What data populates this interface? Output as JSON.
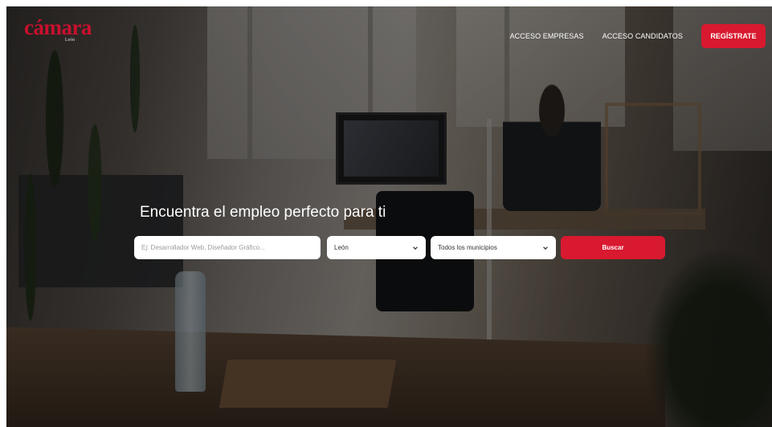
{
  "colors": {
    "accent": "#d8192f",
    "logo_red": "#c8102e"
  },
  "header": {
    "logo": {
      "word": "cámara",
      "sub": "León"
    },
    "nav": {
      "empresas": "ACCESO EMPRESAS",
      "candidatos": "ACCESO CANDIDATOS",
      "register": "REGÍSTRATE"
    }
  },
  "hero": {
    "headline": "Encuentra el empleo perfecto para ti",
    "search": {
      "keyword_placeholder": "Ej: Desarrollador Web, Diseñador Gráfico...",
      "province_selected": "León",
      "municipality_selected": "Todos los municipios",
      "submit_label": "Buscar"
    }
  }
}
